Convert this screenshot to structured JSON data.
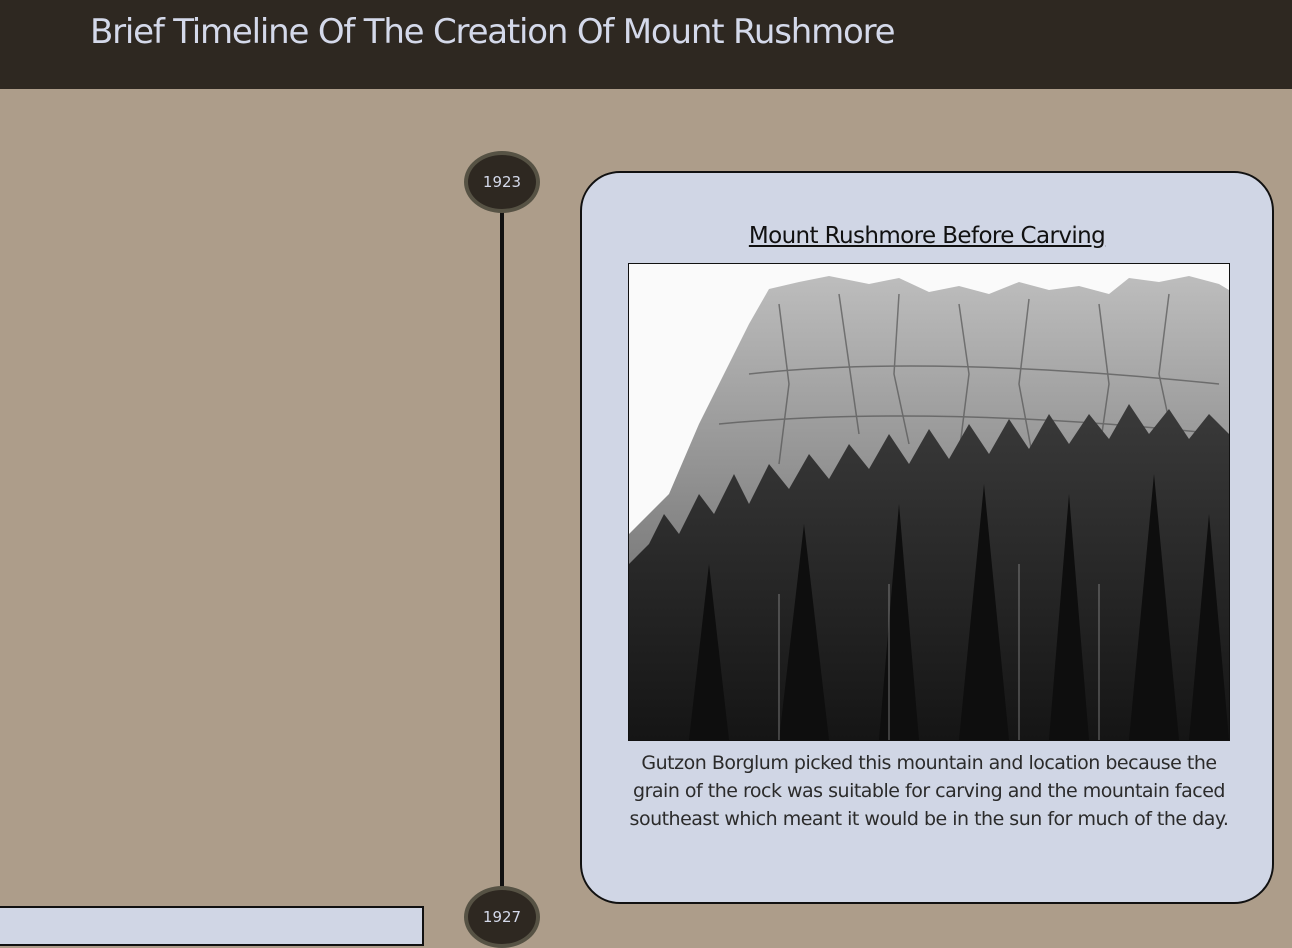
{
  "header": {
    "title": "Brief Timeline Of The Creation Of Mount Rushmore"
  },
  "timeline": {
    "nodes": [
      {
        "year": "1923"
      },
      {
        "year": "1927"
      }
    ]
  },
  "entries": [
    {
      "title": "Mount Rushmore Before Carving",
      "image_alt": "Black and white photo of Mount Rushmore before carving",
      "description": "Gutzon Borglum picked this mountain and location because the grain of the rock was suitable for carving and the mountain faced southeast which meant it would be in the sun for much of the day."
    }
  ],
  "colors": {
    "header_bg": "#2e2821",
    "page_bg": "#ad9d8a",
    "card_bg": "#d0d6e5",
    "title_text": "#d4d9ea"
  }
}
